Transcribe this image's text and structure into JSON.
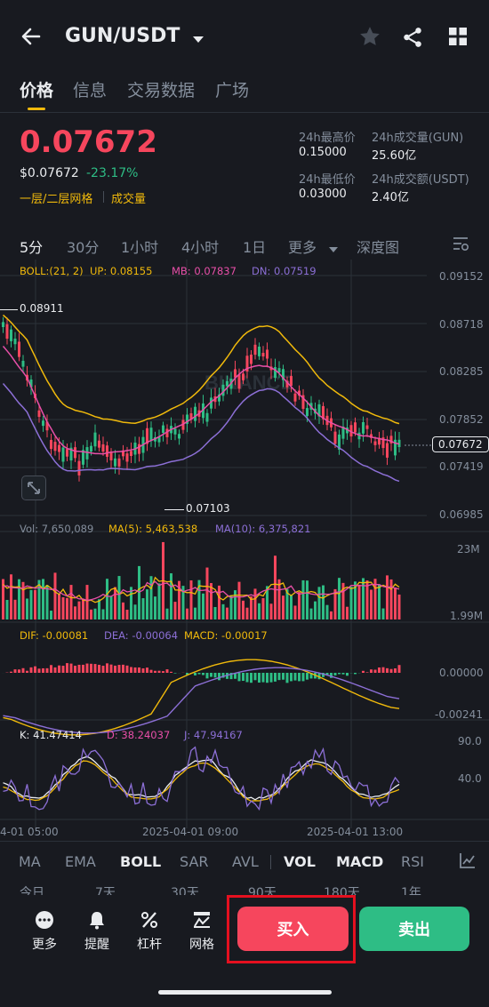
{
  "header": {
    "title": "GUN/USDT"
  },
  "tabs": [
    {
      "label": "价格"
    },
    {
      "label": "信息"
    },
    {
      "label": "交易数据"
    },
    {
      "label": "广场"
    }
  ],
  "price": {
    "last": "0.07672",
    "usd": "$0.07672",
    "change": "-23.17%",
    "tag1": "一层/二层网格",
    "tag2": "成交量"
  },
  "stats": {
    "high_label": "24h最高价",
    "high": "0.15000",
    "vol_label": "24h成交量(GUN)",
    "vol": "25.60亿",
    "low_label": "24h最低价",
    "low": "0.03000",
    "amt_label": "24h成交额(USDT)",
    "amt": "2.40亿"
  },
  "timeframes": [
    {
      "label": "5分"
    },
    {
      "label": "30分"
    },
    {
      "label": "1小时"
    },
    {
      "label": "4小时"
    },
    {
      "label": "1日"
    },
    {
      "label": "更多"
    },
    {
      "label": "深度图"
    }
  ],
  "boll": {
    "title": "BOLL:(21, 2)",
    "up": "UP: 0.08155",
    "mb": "MB: 0.07837",
    "dn": "DN: 0.07519"
  },
  "price_axis": [
    "0.09152",
    "0.08718",
    "0.08285",
    "0.07852",
    "0.07419",
    "0.06985"
  ],
  "current_price_tag": "0.07672",
  "marks": {
    "high": "0.08911",
    "low": "0.07103"
  },
  "watermark": "BINANCE",
  "vol_panel": {
    "vol": "Vol: 7,650,089",
    "ma5": "MA(5): 5,463,538",
    "ma10": "MA(10): 6,375,821",
    "axis_top": "23M",
    "axis_bottom": "1.99M"
  },
  "macd_panel": {
    "dif": "DIF: -0.00081",
    "dea": "DEA: -0.00064",
    "macd": "MACD: -0.00017",
    "axis_top": "0.00000",
    "axis_bottom": "-0.00241"
  },
  "kdj_panel": {
    "k": "K: 41.47414",
    "d": "D: 38.24037",
    "j": "J: 47.94167",
    "axis_top": "90.0",
    "axis_mid": "40.0"
  },
  "time_axis": [
    "4-01 05:00",
    "2025-04-01 09:00",
    "2025-04-01 13:00"
  ],
  "indicators": [
    {
      "label": "MA"
    },
    {
      "label": "EMA"
    },
    {
      "label": "BOLL"
    },
    {
      "label": "SAR"
    },
    {
      "label": "AVL"
    },
    {
      "label": "VOL"
    },
    {
      "label": "MACD"
    },
    {
      "label": "RSI"
    }
  ],
  "periods": [
    "今日",
    "7天",
    "30天",
    "90天",
    "180天",
    "1年"
  ],
  "bottom": {
    "more": "更多",
    "alert": "提醒",
    "leverage": "杠杆",
    "grid": "网格",
    "buy": "买入",
    "sell": "卖出"
  },
  "colors": {
    "up": "#2ebd85",
    "down": "#f6465d",
    "accent": "#f0b90b",
    "mb": "#e84fa8",
    "dn": "#8c6fd6"
  }
}
